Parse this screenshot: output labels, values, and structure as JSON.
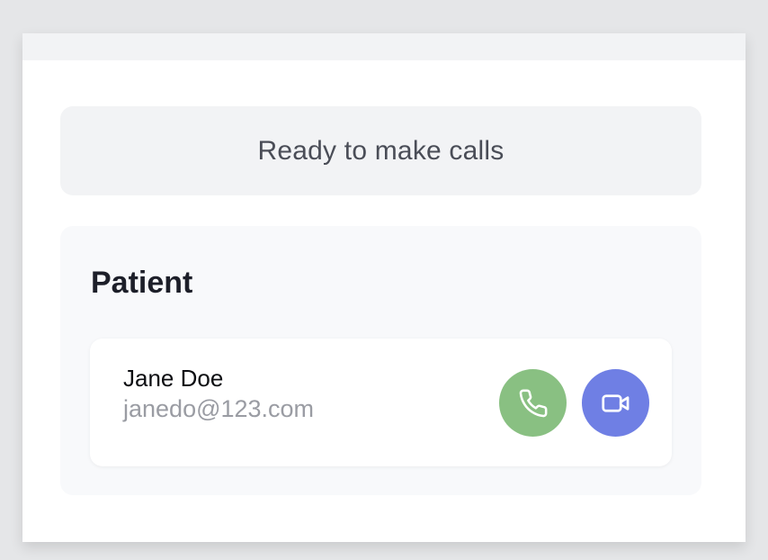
{
  "status": {
    "text": "Ready to make calls"
  },
  "patient_section": {
    "title": "Patient",
    "patient": {
      "name": "Jane Doe",
      "email": "janedo@123.com"
    },
    "actions": [
      {
        "icon": "phone-icon",
        "color": "#89c082"
      },
      {
        "icon": "video-camera-icon",
        "color": "#6f7fe4"
      }
    ]
  },
  "colors": {
    "background": "#e5e6e8",
    "panel": "#ffffff",
    "status_box": "#f2f3f5",
    "section_bg": "#f8f9fb"
  }
}
